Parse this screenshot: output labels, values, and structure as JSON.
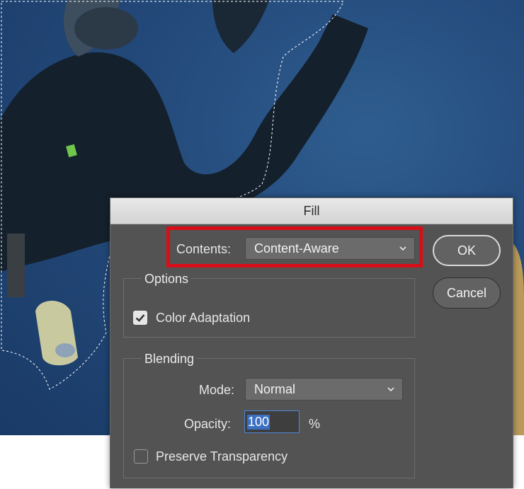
{
  "dialog": {
    "title": "Fill",
    "contents_label": "Contents:",
    "contents_value": "Content-Aware",
    "ok_label": "OK",
    "cancel_label": "Cancel",
    "options": {
      "group_title": "Options",
      "color_adaptation_label": "Color Adaptation",
      "color_adaptation_checked": true
    },
    "blending": {
      "group_title": "Blending",
      "mode_label": "Mode:",
      "mode_value": "Normal",
      "opacity_label": "Opacity:",
      "opacity_value": "100",
      "opacity_unit": "%",
      "preserve_transparency_label": "Preserve Transparency",
      "preserve_transparency_checked": false
    }
  },
  "colors": {
    "highlight": "#d90d17",
    "dialog_bg": "#535353",
    "water": "#23497a"
  }
}
